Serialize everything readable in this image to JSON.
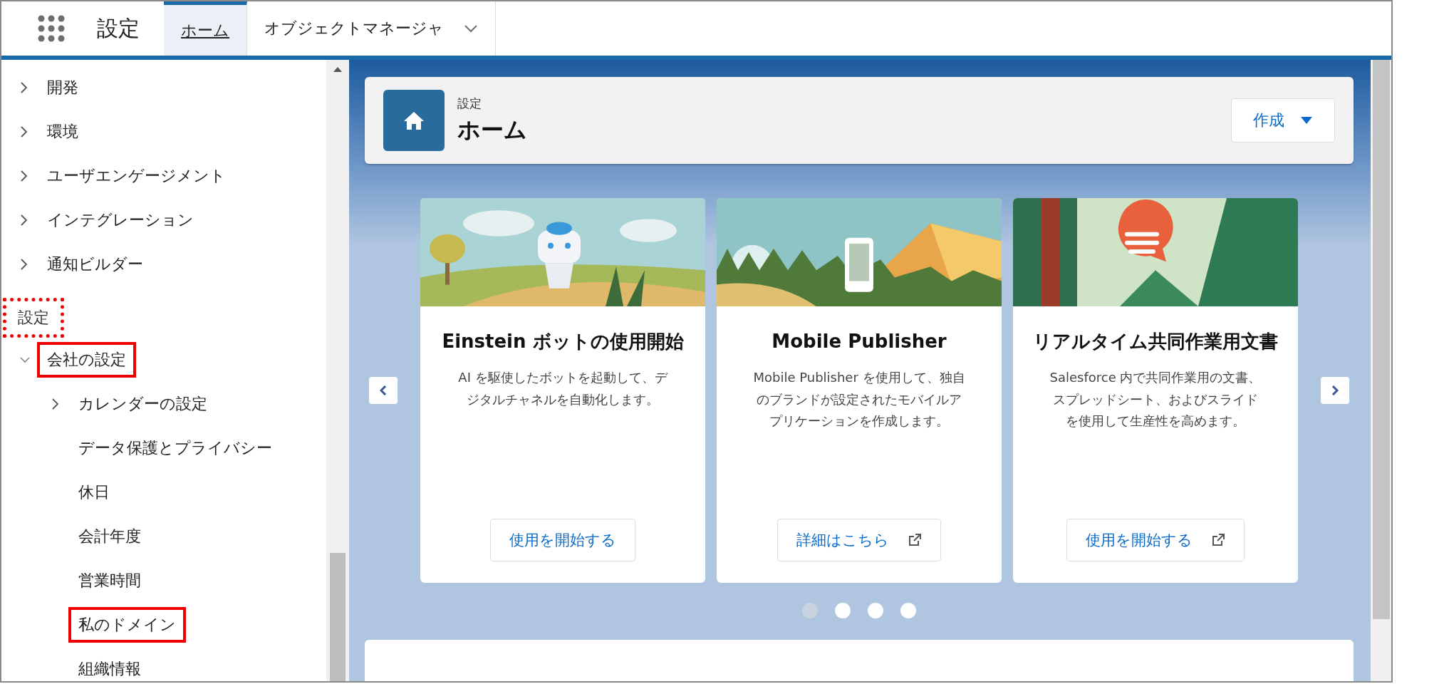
{
  "nav": {
    "app_name": "設定",
    "tabs": [
      {
        "label": "ホーム",
        "selected": true,
        "dropdown": false
      },
      {
        "label": "オブジェクトマネージャ",
        "selected": false,
        "dropdown": true
      }
    ]
  },
  "sidebar": {
    "items": [
      {
        "label": "開発",
        "expanded": false
      },
      {
        "label": "環境",
        "expanded": false
      },
      {
        "label": "ユーザエンゲージメント",
        "expanded": false
      },
      {
        "label": "インテグレーション",
        "expanded": false
      },
      {
        "label": "通知ビルダー",
        "expanded": false
      }
    ],
    "section": {
      "label": "設定",
      "highlighted": true,
      "items": [
        {
          "label": "会社の設定",
          "expanded": true,
          "highlighted": true,
          "children": [
            {
              "label": "カレンダーの設定",
              "expanded": false
            },
            {
              "label": "データ保護とプライバシー"
            },
            {
              "label": "休日"
            },
            {
              "label": "会計年度"
            },
            {
              "label": "営業時間"
            },
            {
              "label": "私のドメイン",
              "highlighted": true
            },
            {
              "label": "組織情報"
            }
          ]
        }
      ]
    }
  },
  "header": {
    "eyebrow": "設定",
    "title": "ホーム",
    "button": "作成"
  },
  "cards": [
    {
      "kind": "robot",
      "title": "Einstein ボットの使用開始",
      "text": "AI を駆使したボットを起動して、デジタルチャネルを自動化します。",
      "button": "使用を開始する",
      "external": false
    },
    {
      "kind": "phone",
      "title": "Mobile Publisher",
      "text": "Mobile Publisher を使用して、独自のブランドが設定されたモバイルアプリケーションを作成します。",
      "button": "詳細はこちら",
      "external": true
    },
    {
      "kind": "chat",
      "title": "リアルタイム共同作業用文書",
      "text": "Salesforce 内で共同作業用の文書、スプレッドシート、およびスライドを使用して生産性を高めます。",
      "button": "使用を開始する",
      "external": true
    }
  ],
  "carousel_dots": [
    {
      "selected": true
    },
    {
      "selected": false
    },
    {
      "selected": false
    },
    {
      "selected": false
    }
  ]
}
